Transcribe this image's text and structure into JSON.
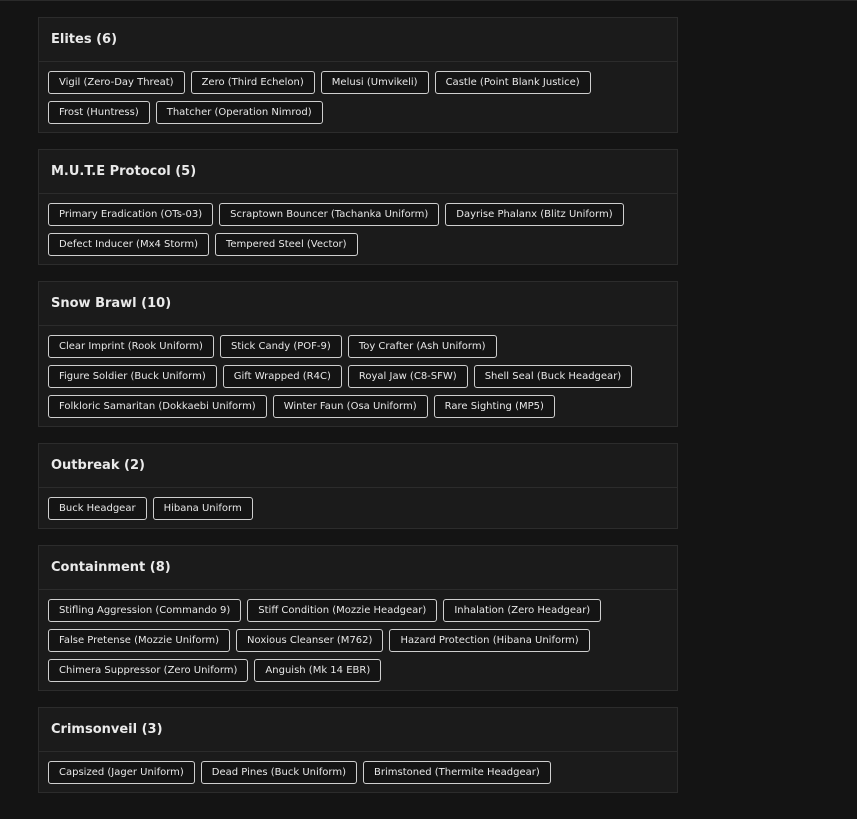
{
  "sections": [
    {
      "title": "Elites (6)",
      "items": [
        "Vigil (Zero-Day Threat)",
        "Zero (Third Echelon)",
        "Melusi (Umvikeli)",
        "Castle (Point Blank Justice)",
        "Frost (Huntress)",
        "Thatcher (Operation Nimrod)"
      ]
    },
    {
      "title": "M.U.T.E Protocol (5)",
      "items": [
        "Primary Eradication (OTs-03)",
        "Scraptown Bouncer (Tachanka Uniform)",
        "Dayrise Phalanx (Blitz Uniform)",
        "Defect Inducer (Mx4 Storm)",
        "Tempered Steel (Vector)"
      ]
    },
    {
      "title": "Snow Brawl (10)",
      "items": [
        "Clear Imprint (Rook Uniform)",
        "Stick Candy (POF-9)",
        "Toy Crafter (Ash Uniform)",
        "Figure Soldier (Buck Uniform)",
        "Gift Wrapped (R4C)",
        "Royal Jaw (C8-SFW)",
        "Shell Seal (Buck Headgear)",
        "Folkloric Samaritan (Dokkaebi Uniform)",
        "Winter Faun (Osa Uniform)",
        "Rare Sighting (MP5)"
      ]
    },
    {
      "title": "Outbreak (2)",
      "items": [
        "Buck Headgear",
        "Hibana Uniform"
      ]
    },
    {
      "title": "Containment (8)",
      "items": [
        "Stifling Aggression (Commando 9)",
        "Stiff Condition (Mozzie Headgear)",
        "Inhalation (Zero Headgear)",
        "False Pretense (Mozzie Uniform)",
        "Noxious Cleanser (M762)",
        "Hazard Protection (Hibana Uniform)",
        "Chimera Suppressor (Zero Uniform)",
        "Anguish (Mk 14 EBR)"
      ]
    },
    {
      "title": "Crimsonveil (3)",
      "items": [
        "Capsized (Jager Uniform)",
        "Dead Pines (Buck Uniform)",
        "Brimstoned (Thermite Headgear)"
      ]
    }
  ]
}
